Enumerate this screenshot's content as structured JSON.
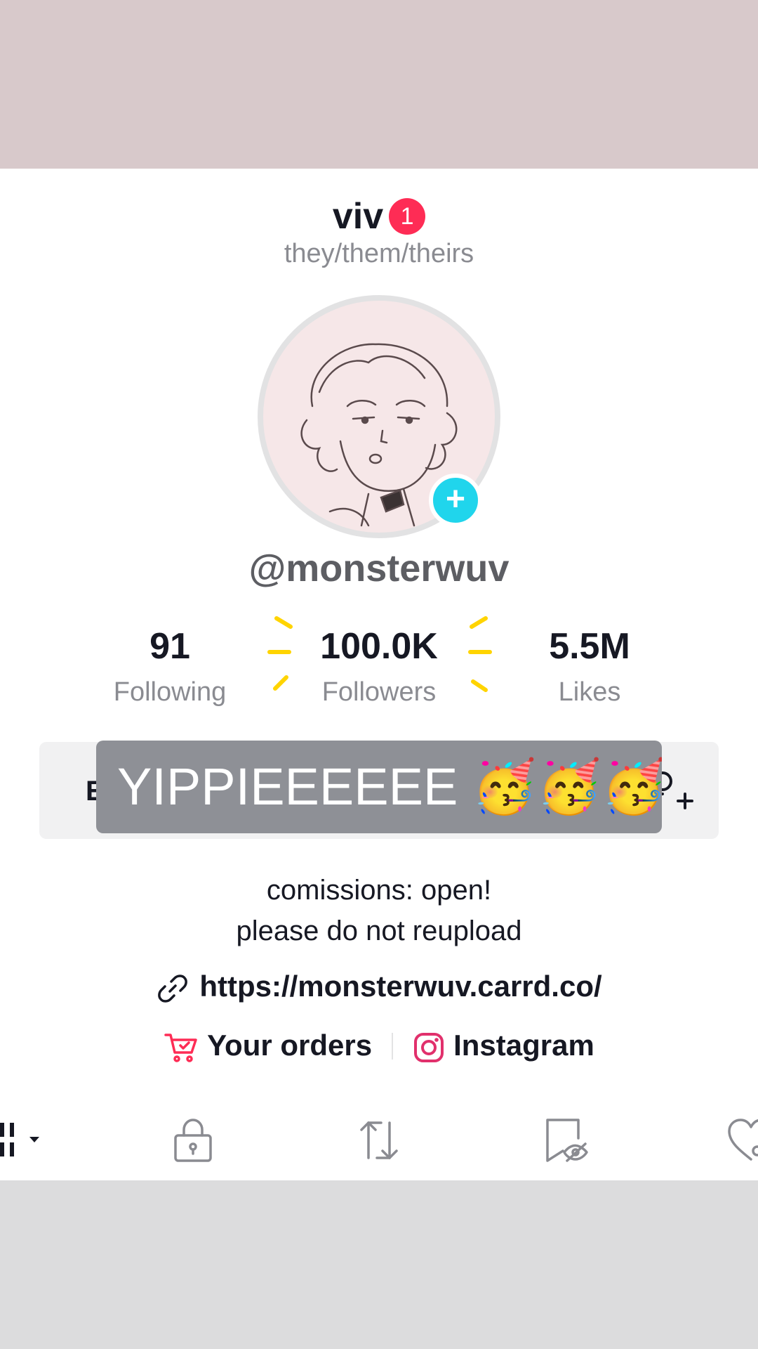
{
  "profile": {
    "display_name": "viv",
    "notification_count": "1",
    "pronouns": "they/them/theirs",
    "username": "@monsterwuv",
    "avatar_add_symbol": "+"
  },
  "stats": {
    "following": {
      "value": "91",
      "label": "Following"
    },
    "followers": {
      "value": "100.0K",
      "label": "Followers"
    },
    "likes": {
      "value": "5.5M",
      "label": "Likes"
    }
  },
  "buttons": {
    "edit_peek": "E"
  },
  "caption": {
    "text": "YIPPIEEEEEE 🥳🥳🥳"
  },
  "bio": {
    "line1": "comissions: open!",
    "line2": "please do not reupload"
  },
  "link": {
    "url": "https://monsterwuv.carrd.co/",
    "icon": "link-icon"
  },
  "chips": {
    "orders": {
      "label": "Your orders",
      "icon": "cart-icon"
    },
    "instagram": {
      "label": "Instagram",
      "icon": "instagram-icon"
    }
  },
  "tabs": [
    {
      "name": "videos-grid",
      "icon": "grid-icon"
    },
    {
      "name": "private",
      "icon": "lock-icon"
    },
    {
      "name": "reposts",
      "icon": "repost-icon"
    },
    {
      "name": "favorites",
      "icon": "bookmark-icon"
    },
    {
      "name": "liked",
      "icon": "heart-icon"
    }
  ],
  "colors": {
    "accent": "#fe2c55",
    "avatar_add": "#20d5ec",
    "secondary_text": "#8a8b91",
    "sparkle": "#ffd400",
    "caption_bg": "#8e9096"
  }
}
